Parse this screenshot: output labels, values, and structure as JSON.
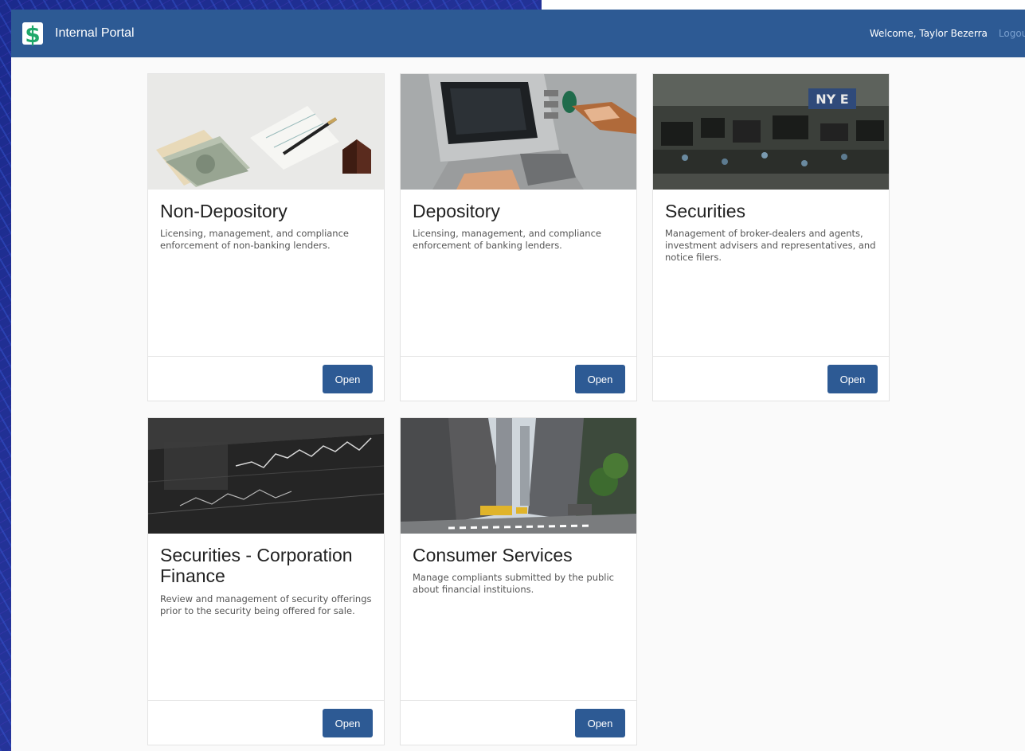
{
  "navbar": {
    "title": "Internal Portal",
    "logo_icon": "dollar-sign-icon",
    "welcome": "Welcome, Taylor Bezerra",
    "logout": "Logout"
  },
  "colors": {
    "navbar": "#2d5a94",
    "button": "#2d5a94",
    "logo": "#1fa86a",
    "background": "#1c2d8f"
  },
  "cards": [
    {
      "title": "Non-Depository",
      "description": "Licensing, management, and compliance enforcement of non-banking lenders.",
      "button": "Open",
      "image": "money-and-pen-photo"
    },
    {
      "title": "Depository",
      "description": "Licensing, management, and compliance enforcement of banking lenders.",
      "button": "Open",
      "image": "atm-photo"
    },
    {
      "title": "Securities",
      "description": "Management of broker-dealers and agents, investment advisers and representatives, and notice filers.",
      "button": "Open",
      "image": "stock-exchange-floor-photo"
    },
    {
      "title": "Securities - Corporation Finance",
      "description": "Review and management of security offerings prior to the security being offered for sale.",
      "button": "Open",
      "image": "stock-chart-screen-photo"
    },
    {
      "title": "Consumer Services",
      "description": "Manage compliants submitted by the public about financial instituions.",
      "button": "Open",
      "image": "city-street-photo"
    }
  ]
}
